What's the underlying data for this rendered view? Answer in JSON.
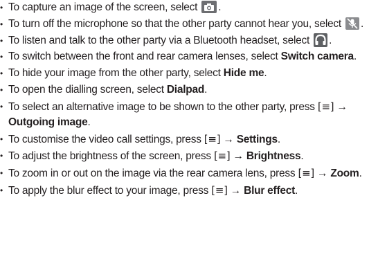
{
  "items": [
    {
      "pre": "To capture an image of the screen, select ",
      "icon": "camera-icon",
      "post": "."
    },
    {
      "pre": "To turn off the microphone so that the other party cannot hear you, select ",
      "icon": "mic-off-icon",
      "post": "."
    },
    {
      "pre": "To listen and talk to the other party via a Bluetooth headset, select ",
      "icon": "headset-icon",
      "post": "."
    },
    {
      "pre": "To switch between the front and rear camera lenses, select ",
      "bold": "Switch camera",
      "post": "."
    },
    {
      "pre": "To hide your image from the other party, select ",
      "bold": "Hide me",
      "post": "."
    },
    {
      "pre": "To open the dialling screen, select ",
      "bold": "Dialpad",
      "post": "."
    },
    {
      "pre": "To select an alternative image to be shown to the other party, press ",
      "key": "[≡]",
      "arrow": " → ",
      "bold": "Outgoing image",
      "post": "."
    },
    {
      "pre": "To customise the video call settings, press ",
      "key": "[≡]",
      "arrow": " → ",
      "bold": "Settings",
      "post": "."
    },
    {
      "pre": "To adjust the brightness of the screen, press ",
      "key": "[≡]",
      "arrow": " → ",
      "bold": "Brightness",
      "post": "."
    },
    {
      "pre": "To zoom in or out on the image via the rear camera lens, press ",
      "key": "[≡]",
      "arrow": " → ",
      "bold": "Zoom",
      "post": "."
    },
    {
      "pre": "To apply the blur effect to your image, press ",
      "key": "[≡]",
      "arrow": " → ",
      "bold": "Blur effect",
      "post": "."
    }
  ]
}
